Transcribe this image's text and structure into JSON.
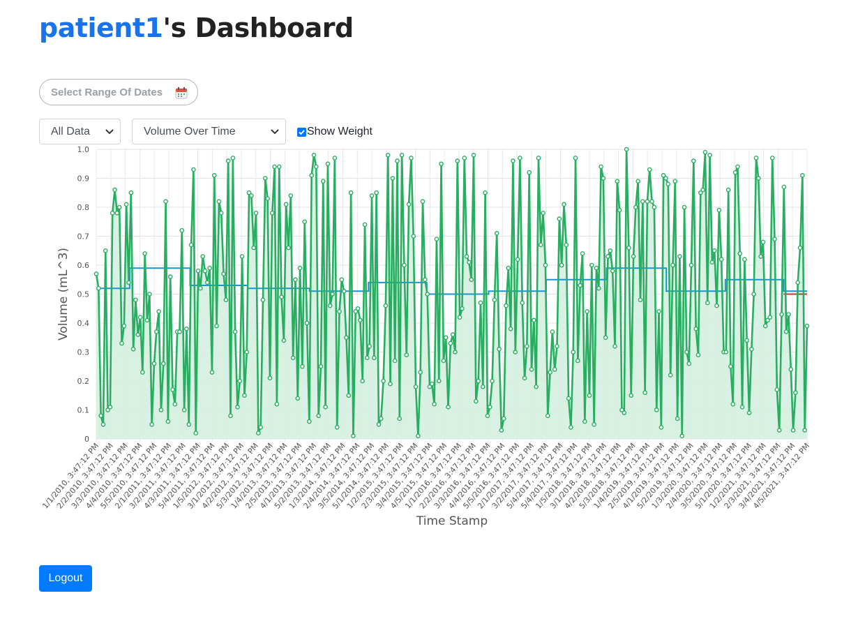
{
  "header": {
    "username": "patient1",
    "title_suffix": "'s Dashboard"
  },
  "filters": {
    "date_range_placeholder": "Select Range Of Dates",
    "data_select_value": "All Data",
    "metric_select_value": "Volume Over Time",
    "show_weight_label": "Show Weight",
    "show_weight_checked": true
  },
  "logout_label": "Logout",
  "colors": {
    "accent": "#1a73e8",
    "volume_line": "#27ae60",
    "volume_fill": "#d5f0df",
    "weight_line": "#1e90d6",
    "button": "#007bff"
  },
  "chart_data": {
    "type": "line",
    "xlabel": "Time Stamp",
    "ylabel": "Volume (mL^3)",
    "ylim": [
      0,
      1.0
    ],
    "yticks": [
      0,
      0.1,
      0.2,
      0.3,
      0.4,
      0.5,
      0.6,
      0.7,
      0.8,
      0.9,
      1.0
    ],
    "grid": true,
    "x_tick_labels": [
      "1/1/2010, 3:47:12 PM",
      "2/2/2010, 3:47:12 PM",
      "3/3/2010, 3:47:12 PM",
      "4/4/2010, 3:47:12 PM",
      "5/5/2010, 3:47:12 PM",
      "2/1/2011, 3:47:12 PM",
      "3/2/2011, 3:47:12 PM",
      "4/3/2011, 3:47:12 PM",
      "5/4/2011, 3:47:12 PM",
      "1/5/2012, 3:47:12 PM",
      "3/1/2012, 3:47:12 PM",
      "4/2/2012, 3:47:12 PM",
      "5/3/2012, 3:47:12 PM",
      "1/4/2013, 3:47:12 PM",
      "2/5/2013, 3:47:12 PM",
      "4/1/2013, 3:47:12 PM",
      "5/2/2013, 3:47:12 PM",
      "1/3/2014, 3:47:12 PM",
      "2/4/2014, 3:47:12 PM",
      "3/5/2014, 3:47:12 PM",
      "5/1/2014, 3:47:12 PM",
      "1/2/2015, 3:47:12 PM",
      "2/3/2015, 3:47:12 PM",
      "3/4/2015, 3:47:12 PM",
      "4/5/2015, 3:47:12 PM",
      "1/1/2016, 3:47:12 PM",
      "2/2/2016, 3:47:12 PM",
      "3/3/2016, 3:47:12 PM",
      "4/4/2016, 3:47:12 PM",
      "5/5/2016, 3:47:12 PM",
      "2/1/2017, 3:47:12 PM",
      "3/2/2017, 3:47:12 PM",
      "5/4/2017, 3:47:12 PM",
      "5/4/2017, 3:47:12 PM",
      "1/5/2018, 3:47:12 PM",
      "3/1/2018, 3:47:12 PM",
      "4/2/2018, 3:47:12 PM",
      "5/3/2018, 3:47:12 PM",
      "1/4/2019, 3:47:12 PM",
      "2/5/2019, 3:47:12 PM",
      "4/1/2019, 3:47:12 PM",
      "5/2/2019, 3:47:12 PM",
      "1/3/2020, 3:47:12 PM",
      "2/4/2020, 3:47:12 PM",
      "3/5/2020, 3:47:12 PM",
      "5/1/2020, 3:47:12 PM",
      "1/2/2021, 3:47:12 PM",
      "2/3/2021, 3:47:12 PM",
      "3/4/2021, 3:47:12 PM",
      "4/5/2021, 3:47:12 PM"
    ],
    "series": [
      {
        "values": [
          0.57,
          0.52,
          0.08,
          0.05,
          0.65,
          0.1,
          0.11,
          0.78,
          0.86,
          0.78,
          0.8,
          0.33,
          0.39,
          0.81,
          0.54,
          0.85,
          0.31,
          0.48,
          0.36,
          0.42,
          0.23,
          0.64,
          0.41,
          0.5,
          0.05,
          0.26,
          0.37,
          0.44,
          0.1,
          0.26,
          0.82,
          0.06,
          0.56,
          0.17,
          0.12,
          0.37,
          0.37,
          0.72,
          0.1,
          0.38,
          0.05,
          0.67,
          0.93,
          0.02,
          0.58,
          0.52,
          0.63,
          0.58,
          0.54,
          0.59,
          0.23,
          0.91,
          0.39,
          0.82,
          0.78,
          0.57,
          0.48,
          0.96,
          0.08,
          0.97,
          0.37,
          0.11,
          0.2,
          0.63,
          0.15,
          0.3,
          0.85,
          0.84,
          0.66,
          0.78,
          0.02,
          0.04,
          0.48,
          0.9,
          0.83,
          0.21,
          0.78,
          0.94,
          0.12,
          0.94,
          0.49,
          0.34,
          0.81,
          0.66,
          0.84,
          0.28,
          0.55,
          0.14,
          0.59,
          0.25,
          0.75,
          0.4,
          0.06,
          0.91,
          0.98,
          0.94,
          0.08,
          0.25,
          0.89,
          0.11,
          0.95,
          0.46,
          0.5,
          0.97,
          0.04,
          0.44,
          0.55,
          0.51,
          0.35,
          0.15,
          0.85,
          0.01,
          0.44,
          0.45,
          0.41,
          0.2,
          0.74,
          0.28,
          0.32,
          0.84,
          0.28,
          0.85,
          0.05,
          0.07,
          0.2,
          0.46,
          0.98,
          0.19,
          0.9,
          0.27,
          0.96,
          0.07,
          0.98,
          0.6,
          0.29,
          0.81,
          0.97,
          0.7,
          0.18,
          0.01,
          0.23,
          0.82,
          0.55,
          0.5,
          0.18,
          0.19,
          0.12,
          0.69,
          0.2,
          0.95,
          0.27,
          0.35,
          0.11,
          0.33,
          0.36,
          0.3,
          0.96,
          0.42,
          0.45,
          0.97,
          0.63,
          0.61,
          0.55,
          0.98,
          0.13,
          0.2,
          0.47,
          0.18,
          0.85,
          0.08,
          0.11,
          0.2,
          0.48,
          0.71,
          0.31,
          0.03,
          0.07,
          0.46,
          0.59,
          0.38,
          0.96,
          0.3,
          0.62,
          0.97,
          0.47,
          0.21,
          0.32,
          0.92,
          0.24,
          0.41,
          0.18,
          0.97,
          0.67,
          0.78,
          0.6,
          0.08,
          0.23,
          0.37,
          0.24,
          0.32,
          0.76,
          0.6,
          0.81,
          0.67,
          0.14,
          0.04,
          0.3,
          0.97,
          0.27,
          0.53,
          0.64,
          0.06,
          0.44,
          0.15,
          0.6,
          0.05,
          0.59,
          0.52,
          0.94,
          0.9,
          0.35,
          0.63,
          0.65,
          0.58,
          0.32,
          0.89,
          0.79,
          0.1,
          0.09,
          1.0,
          0.66,
          0.15,
          0.63,
          0.8,
          0.89,
          0.48,
          0.82,
          0.16,
          0.82,
          0.93,
          0.82,
          0.8,
          0.1,
          0.44,
          0.04,
          0.91,
          0.9,
          0.88,
          0.22,
          0.6,
          0.89,
          0.07,
          0.63,
          0.01,
          0.8,
          0.3,
          0.26,
          0.6,
          0.96,
          0.38,
          0.29,
          0.85,
          0.86,
          0.99,
          0.47,
          0.98,
          0.61,
          0.65,
          0.46,
          0.79,
          0.62,
          0.3,
          0.3,
          0.86,
          0.25,
          0.12,
          0.92,
          0.94,
          0.64,
          0.11,
          0.62,
          0.34,
          0.09,
          0.31,
          0.5,
          0.97,
          0.9,
          0.63,
          0.68,
          0.39,
          0.41,
          0.42,
          0.97,
          0.69,
          0.17,
          0.03,
          0.43,
          0.87,
          0.37,
          0.43,
          0.24,
          0.03,
          0.16,
          0.54,
          0.66,
          0.91,
          0.03,
          0.39
        ]
      },
      {
        "segments": [
          {
            "x0": 0.0,
            "x1": 0.047,
            "value": 0.52
          },
          {
            "x0": 0.047,
            "x1": 0.132,
            "value": 0.59
          },
          {
            "x0": 0.132,
            "x1": 0.213,
            "value": 0.53
          },
          {
            "x0": 0.213,
            "x1": 0.3,
            "value": 0.52
          },
          {
            "x0": 0.3,
            "x1": 0.383,
            "value": 0.51
          },
          {
            "x0": 0.383,
            "x1": 0.465,
            "value": 0.54
          },
          {
            "x0": 0.465,
            "x1": 0.552,
            "value": 0.5
          },
          {
            "x0": 0.552,
            "x1": 0.633,
            "value": 0.51
          },
          {
            "x0": 0.633,
            "x1": 0.718,
            "value": 0.55
          },
          {
            "x0": 0.718,
            "x1": 0.802,
            "value": 0.59
          },
          {
            "x0": 0.802,
            "x1": 0.885,
            "value": 0.51
          },
          {
            "x0": 0.885,
            "x1": 0.967,
            "value": 0.55
          },
          {
            "x0": 0.967,
            "x1": 1.0,
            "value": 0.51
          }
        ]
      },
      {
        "segments": [
          {
            "x0": 0.967,
            "x1": 1.0,
            "value": 0.5
          }
        ]
      }
    ]
  }
}
